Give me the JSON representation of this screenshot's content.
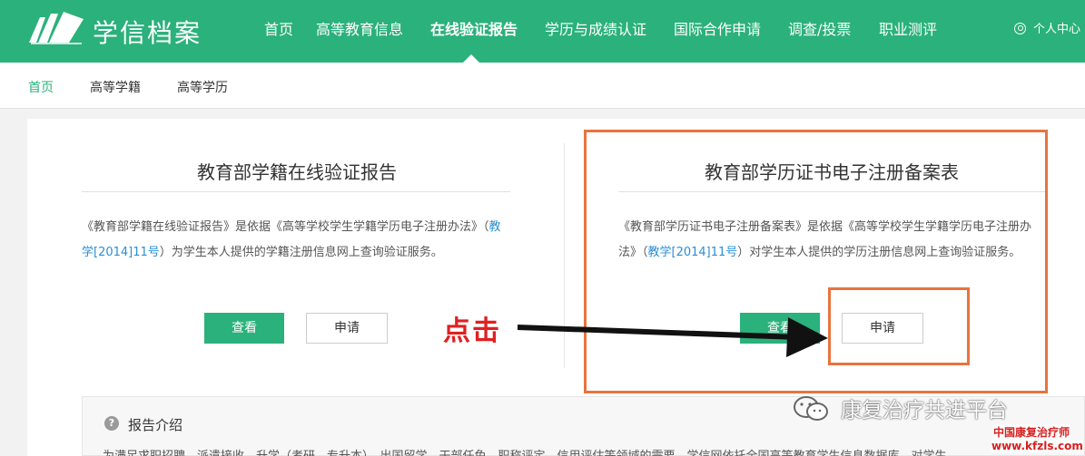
{
  "header": {
    "brand": "学信档案",
    "nav": [
      "首页",
      "高等教育信息",
      "在线验证报告",
      "学历与成绩认证",
      "国际合作申请",
      "调查/投票",
      "职业测评"
    ],
    "active_nav": "在线验证报告",
    "user_label": "个人中心"
  },
  "subnav": {
    "items": [
      "首页",
      "高等学籍",
      "高等学历"
    ],
    "active": "首页"
  },
  "cards": [
    {
      "title": "教育部学籍在线验证报告",
      "desc_before": "《教育部学籍在线验证报告》是依据《高等学校学生学籍学历电子注册办法》（",
      "desc_link": "教学[2014]11号",
      "desc_after": "）为学生本人提供的学籍注册信息网上查询验证服务。",
      "view_label": "查看",
      "apply_label": "申请"
    },
    {
      "title": "教育部学历证书电子注册备案表",
      "desc_before": "《教育部学历证书电子注册备案表》是依据《高等学校学生学籍学历电子注册办法》（",
      "desc_link": "教学[2014]11号",
      "desc_after": "）对学生本人提供的学历注册信息网上查询验证服务。",
      "view_label": "查看",
      "apply_label": "申请"
    }
  ],
  "annotation": {
    "click_text": "点击",
    "highlight_color": "#e8733e",
    "text_color": "#e02020"
  },
  "intro": {
    "icon": "question-icon",
    "title": "报告介绍",
    "text": "为满足求职招聘、派遣接收、升学（考研、专升本）、出国留学、干部任免、职称评定、信用评估等领域的需要，学信网依托全国高等教育学生信息数据库，对学生"
  },
  "watermark": {
    "platform": "康复治疗共进平台",
    "site_name": "中国康复治疗师",
    "site_url": "www.kfzls.com"
  },
  "colors": {
    "brand_green": "#2bb17b",
    "link_blue": "#2a8fd6"
  }
}
